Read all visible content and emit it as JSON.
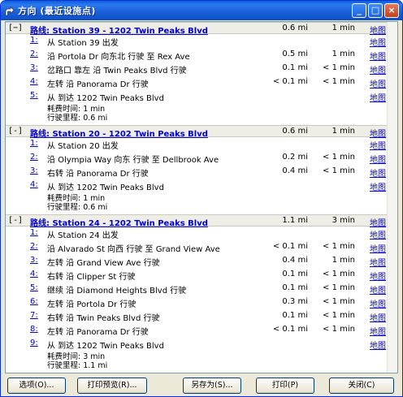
{
  "window": {
    "title": "方向 (最近设施点)",
    "minimize_label": "_",
    "maximize_label": "□",
    "close_label": "×"
  },
  "routes": [
    {
      "toggle": "[−]",
      "title": "路线: Station 39 - 1202 Twin Peaks Blvd",
      "distance": "0.6 mi",
      "time": "1 min",
      "map": "地图",
      "steps": [
        {
          "num": "1:",
          "instruction": "从 Station 39 出发",
          "distance": "",
          "time": "",
          "map": "地图"
        },
        {
          "num": "2:",
          "instruction": "沿 Portola Dr 向东北 行驶 至 Rex Ave",
          "distance": "0.5 mi",
          "time": "1 min",
          "map": "地图"
        },
        {
          "num": "3:",
          "instruction": "岔路口 靠左 沿 Twin Peaks Blvd 行驶",
          "distance": "0.1 mi",
          "time": "< 1 min",
          "map": "地图"
        },
        {
          "num": "4:",
          "instruction": "左转 沿 Panorama Dr 行驶",
          "distance": "< 0.1 mi",
          "time": "< 1 min",
          "map": "地图"
        },
        {
          "num": "5:",
          "instruction": "从 到达 1202 Twin Peaks Blvd",
          "distance": "",
          "time": "",
          "map": "地图"
        }
      ],
      "summary_time": "耗费时间: 1 min",
      "summary_distance": "行驶里程: 0.6 mi"
    },
    {
      "toggle": "[-]",
      "title": "路线: Station 20 - 1202 Twin Peaks Blvd",
      "distance": "0.6 mi",
      "time": "1 min",
      "map": "地图",
      "steps": [
        {
          "num": "1:",
          "instruction": "从 Station 20 出发",
          "distance": "",
          "time": "",
          "map": "地图"
        },
        {
          "num": "2:",
          "instruction": "沿 Olympia Way 向东 行驶 至 Dellbrook Ave",
          "distance": "0.2 mi",
          "time": "< 1 min",
          "map": "地图"
        },
        {
          "num": "3:",
          "instruction": "右转 沿 Panorama Dr 行驶",
          "distance": "0.4 mi",
          "time": "< 1 min",
          "map": "地图"
        },
        {
          "num": "4:",
          "instruction": "从 到达 1202 Twin Peaks Blvd",
          "distance": "",
          "time": "",
          "map": "地图"
        }
      ],
      "summary_time": "耗费时间: 1 min",
      "summary_distance": "行驶里程: 0.6 mi"
    },
    {
      "toggle": "[-]",
      "title": "路线: Station 24 - 1202 Twin Peaks Blvd",
      "distance": "1.1 mi",
      "time": "3 min",
      "map": "地图",
      "steps": [
        {
          "num": "1:",
          "instruction": "从 Station 24 出发",
          "distance": "",
          "time": "",
          "map": "地图"
        },
        {
          "num": "2:",
          "instruction": "沿 Alvarado St 向西 行驶 至 Grand View Ave",
          "distance": "< 0.1 mi",
          "time": "< 1 min",
          "map": "地图"
        },
        {
          "num": "3:",
          "instruction": "左转 沿 Grand View Ave 行驶",
          "distance": "0.4 mi",
          "time": "1 min",
          "map": "地图"
        },
        {
          "num": "4:",
          "instruction": "右转 沿 Clipper St 行驶",
          "distance": "0.1 mi",
          "time": "< 1 min",
          "map": "地图"
        },
        {
          "num": "5:",
          "instruction": "继续 沿 Diamond Heights Blvd 行驶",
          "distance": "0.1 mi",
          "time": "< 1 min",
          "map": "地图"
        },
        {
          "num": "6:",
          "instruction": "左转 沿 Portola Dr 行驶",
          "distance": "0.3 mi",
          "time": "< 1 min",
          "map": "地图"
        },
        {
          "num": "7:",
          "instruction": "右转 沿 Twin Peaks Blvd 行驶",
          "distance": "0.1 mi",
          "time": "< 1 min",
          "map": "地图"
        },
        {
          "num": "8:",
          "instruction": "左转 沿 Panorama Dr 行驶",
          "distance": "< 0.1 mi",
          "time": "< 1 min",
          "map": "地图"
        },
        {
          "num": "9:",
          "instruction": "从 到达 1202 Twin Peaks Blvd",
          "distance": "",
          "time": "",
          "map": "地图"
        }
      ],
      "summary_time": "耗费时间: 3 min",
      "summary_distance": "行驶里程: 1.1 mi"
    }
  ],
  "footer": {
    "options": "选项(O)...",
    "print_preview": "打印预览(R)...",
    "save_as": "另存为(S)...",
    "print": "打印(P)",
    "close": "关闭(C)"
  },
  "colors": {
    "title_bar": "#1a5fd8",
    "link": "#0000cc",
    "route_header_bg": "#eeeee6"
  }
}
